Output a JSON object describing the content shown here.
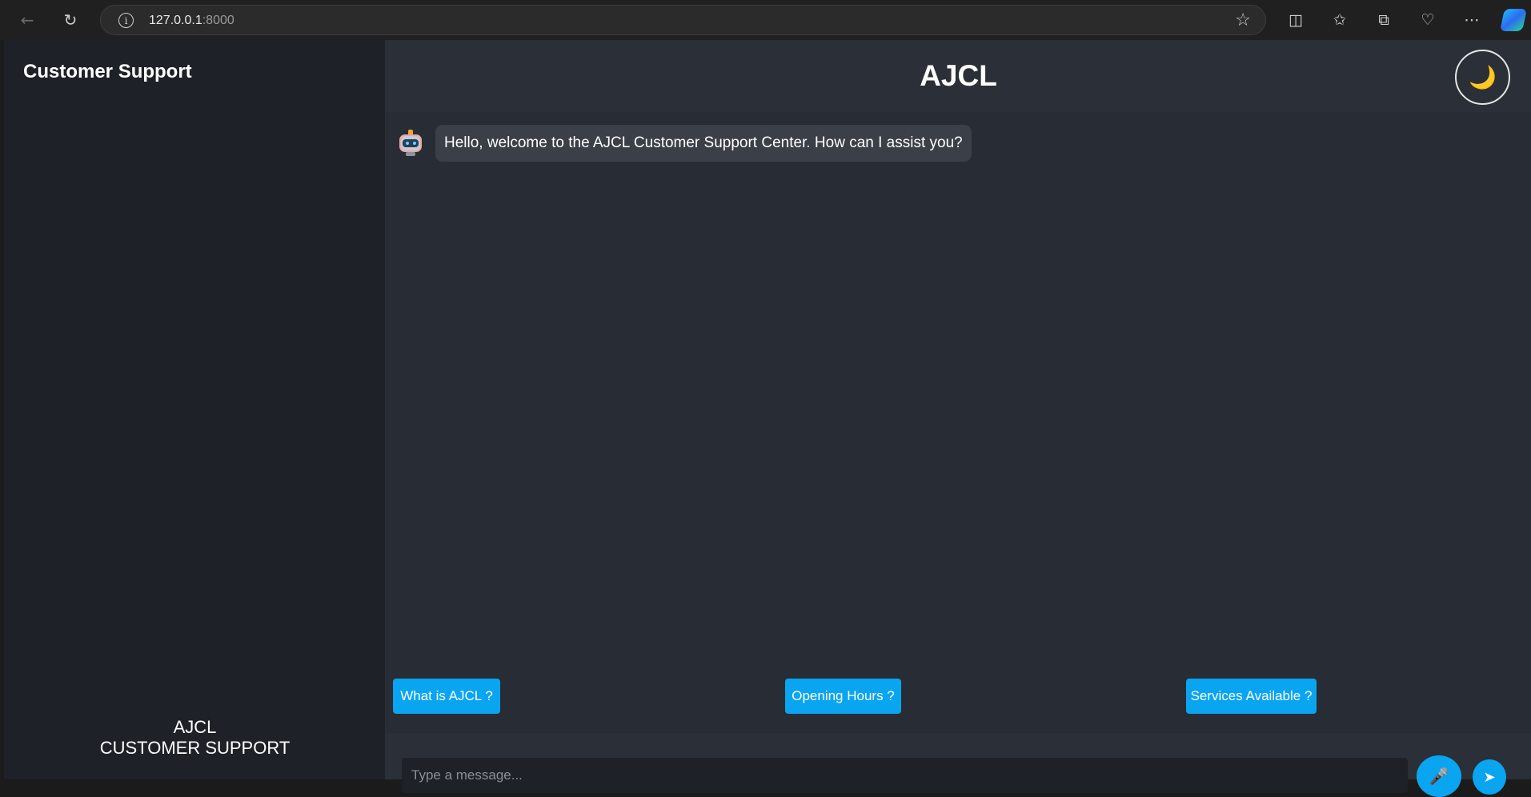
{
  "browser": {
    "url_host": "127.0.0.1",
    "url_port": ":8000",
    "icons": [
      "back-arrow-icon",
      "reload-icon",
      "info-icon",
      "favorite-star-icon",
      "split-screen-icon",
      "favorites-icon",
      "collections-icon",
      "browser-essentials-icon",
      "more-icon",
      "copilot-icon"
    ]
  },
  "sidebar": {
    "title": "Customer Support",
    "footer_line1": "AJCL",
    "footer_line2": "CUSTOMER SUPPORT"
  },
  "header": {
    "title": "AJCL",
    "theme_toggle_icon": "🌙"
  },
  "chat": {
    "messages": [
      {
        "sender": "bot",
        "avatar_icon": "robot-icon",
        "text": "Hello, welcome to the AJCL Customer Support Center. How can I assist you?"
      }
    ]
  },
  "quick_replies": [
    {
      "label": "What is AJCL ?"
    },
    {
      "label": "Opening Hours ?"
    },
    {
      "label": "Services Available ?"
    }
  ],
  "composer": {
    "placeholder": "Type a message...",
    "mic_icon": "microphone-icon",
    "send_icon": "send-icon"
  },
  "colors": {
    "accent": "#0aa5f0",
    "sidebar_bg": "#1e2128",
    "main_bg": "#282c34",
    "bubble_bg": "#3b3f47"
  }
}
